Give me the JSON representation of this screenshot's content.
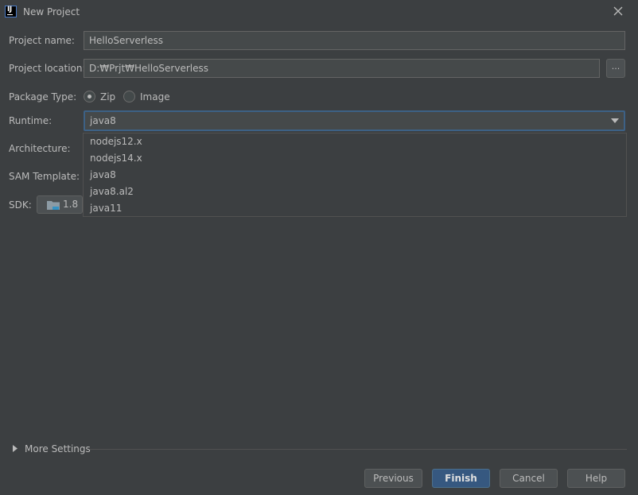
{
  "window": {
    "title": "New Project"
  },
  "form": {
    "project_name_label": "Project name:",
    "project_name_value": "HelloServerless",
    "project_location_label": "Project location:",
    "project_location_value": "D:₩Prjt₩HelloServerless",
    "browse_label": "...",
    "package_type_label": "Package Type:",
    "package_options": [
      "Zip",
      "Image"
    ],
    "package_selected": "Zip",
    "runtime_label": "Runtime:",
    "runtime_value": "java8",
    "architecture_label": "Architecture:",
    "sam_template_label": "SAM Template:",
    "sdk_label": "SDK:",
    "sdk_value": "1.8"
  },
  "runtime_dropdown": {
    "options": [
      "nodejs12.x",
      "nodejs14.x",
      "java8",
      "java8.al2",
      "java11"
    ]
  },
  "more_settings": {
    "label": "More Settings"
  },
  "buttons": {
    "previous": "Previous",
    "finish": "Finish",
    "cancel": "Cancel",
    "help": "Help"
  },
  "colors": {
    "background": "#3c3f41",
    "field_bg": "#45494a",
    "focus_border": "#3d6185",
    "primary_button": "#365880",
    "text": "#bbbbbb"
  }
}
